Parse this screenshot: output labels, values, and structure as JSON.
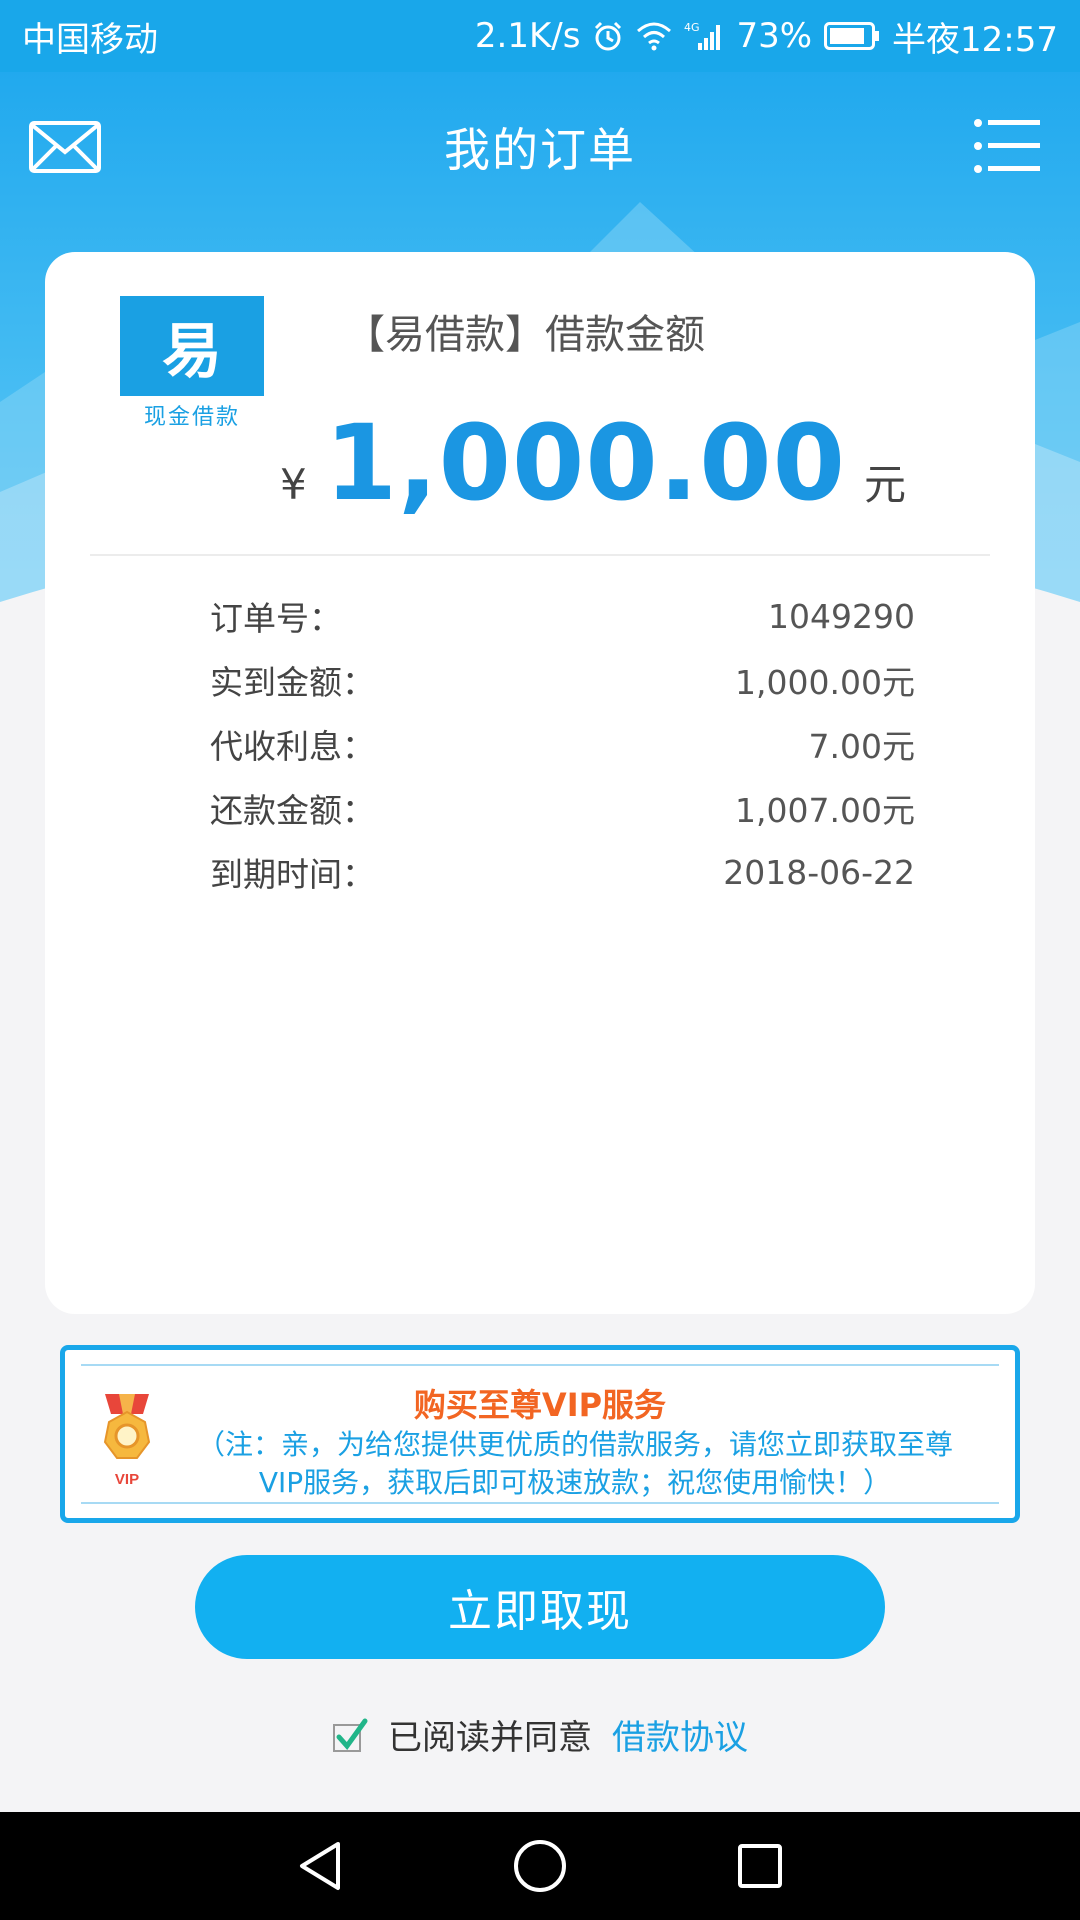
{
  "status_bar": {
    "carrier": "中国移动",
    "speed": "2.1K/s",
    "network": "4G",
    "battery": "73%",
    "time": "半夜12:57"
  },
  "header": {
    "title": "我的订单",
    "left_icon": "mail-icon",
    "right_icon": "menu-icon"
  },
  "card": {
    "logo": {
      "char": "易",
      "text": "现金借款"
    },
    "loan_title": "【易借款】借款金额",
    "currency_symbol": "¥",
    "amount": "1,000.00",
    "amount_unit": "元",
    "details": [
      {
        "label": "订单号：",
        "value": "1049290"
      },
      {
        "label": "实到金额：",
        "value": "1,000.00元"
      },
      {
        "label": "代收利息：",
        "value": "7.00元"
      },
      {
        "label": "还款金额：",
        "value": "1,007.00元"
      },
      {
        "label": "到期时间：",
        "value": "2018-06-22"
      }
    ]
  },
  "vip": {
    "badge_text": "VIP",
    "title": "购买至尊VIP服务",
    "note": "（注：亲，为给您提供更优质的借款服务，请您立即获取至尊VIP服务，获取后即可极速放款；祝您使用愉快！）"
  },
  "actions": {
    "withdraw_label": "立即取现",
    "agree_text": "已阅读并同意",
    "agreement_link": "借款协议",
    "agreed": true
  },
  "colors": {
    "primary": "#19a7ea",
    "amount": "#1b96e2",
    "vip_title": "#f26522"
  }
}
